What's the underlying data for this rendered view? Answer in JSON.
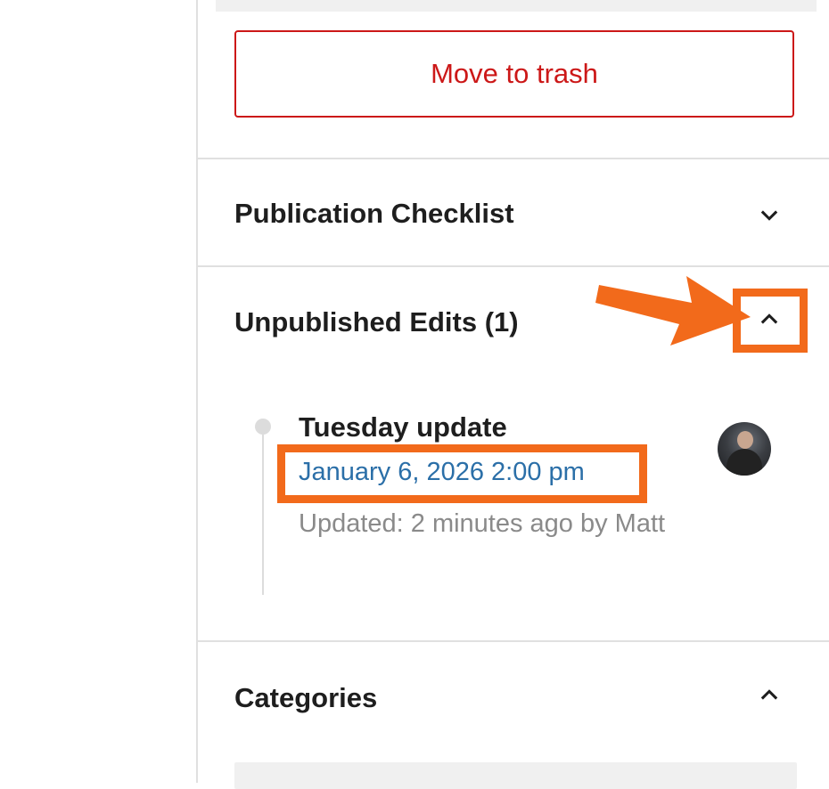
{
  "sidebar": {
    "trash_button": "Move to trash",
    "panels": [
      {
        "title": "Publication Checklist",
        "state": "collapsed",
        "icon": "chevron-down-icon"
      },
      {
        "title": "Unpublished Edits (1)",
        "state": "expanded",
        "icon": "chevron-up-icon"
      },
      {
        "title": "Categories",
        "state": "expanded",
        "icon": "chevron-up-icon"
      }
    ]
  },
  "revision": {
    "title": "Tuesday update",
    "date": "January 6, 2026 2:00 pm",
    "meta": "Updated: 2 minutes ago by Matt",
    "avatar_icon": "user-avatar"
  },
  "annotations": {
    "arrow_icon": "orange-arrow-icon",
    "highlight_color": "#f26a1b"
  },
  "colors": {
    "danger": "#cc1818",
    "link": "#2b6fa8",
    "muted": "#8a8a8a",
    "divider": "#e0e0e0"
  }
}
